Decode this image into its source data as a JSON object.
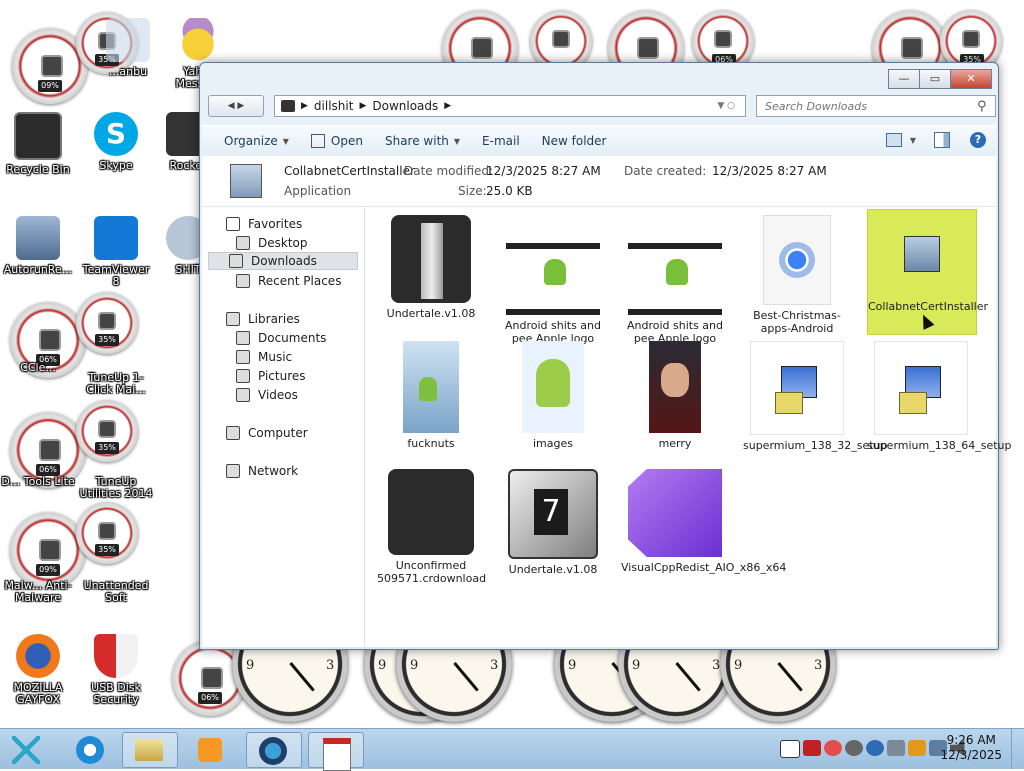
{
  "desktop": {
    "icons": [
      {
        "label": "Recycle Bin"
      },
      {
        "label": "Skype"
      },
      {
        "label": "Rocket"
      },
      {
        "label": "AutorunRe..."
      },
      {
        "label": "TeamViewer 8"
      },
      {
        "label": "SHIT"
      },
      {
        "label": "CCle..."
      },
      {
        "label": "TuneUp 1-Click Mai..."
      },
      {
        "label": "D... Tools Lite"
      },
      {
        "label": "TuneUp Utilities 2014"
      },
      {
        "label": "Malw... Anti-Malware"
      },
      {
        "label": "Unattended Soft"
      },
      {
        "label": "MOZILLA GAYFOX"
      },
      {
        "label": "USB Disk Security"
      },
      {
        "label": "...anbu"
      },
      {
        "label": "Yah... Messe..."
      }
    ],
    "gauge_readings": [
      "09%",
      "35%",
      "06%",
      "35%",
      "06%",
      "35%",
      "09%",
      "35%",
      "06%",
      "35%",
      "35%",
      "06%"
    ]
  },
  "window": {
    "controls": {
      "minimize": "—",
      "maximize": "▭",
      "close": "✕"
    },
    "address": {
      "segments": [
        "dillshit",
        "Downloads"
      ]
    },
    "search": {
      "placeholder": "Search Downloads"
    },
    "toolbar": {
      "organize": "Organize",
      "open": "Open",
      "share_with": "Share with",
      "email": "E-mail",
      "new_folder": "New folder"
    },
    "details": {
      "name": "CollabnetCertInstaller",
      "type": "Application",
      "date_modified_label": "Date modified:",
      "date_modified": "12/3/2025 8:27 AM",
      "size_label": "Size:",
      "size": "25.0 KB",
      "date_created_label": "Date created:",
      "date_created": "12/3/2025 8:27 AM"
    },
    "nav": {
      "favorites": "Favorites",
      "desktop": "Desktop",
      "downloads": "Downloads",
      "recent_places": "Recent Places",
      "libraries": "Libraries",
      "documents": "Documents",
      "music": "Music",
      "pictures": "Pictures",
      "videos": "Videos",
      "computer": "Computer",
      "network": "Network"
    },
    "files": [
      {
        "name": "Undertale.v1.08",
        "icon": "archive-icon"
      },
      {
        "name": "Android shits and pee Apple logo",
        "icon": "video-thumb"
      },
      {
        "name": "Android shits and pee Apple logo",
        "icon": "video-thumb"
      },
      {
        "name": "Best-Christmas-apps-Android",
        "icon": "chrome-document"
      },
      {
        "name": "CollabnetCertInstaller",
        "icon": "installer-icon"
      },
      {
        "name": "fucknuts",
        "icon": "image-thumb"
      },
      {
        "name": "images",
        "icon": "image-thumb"
      },
      {
        "name": "merry",
        "icon": "image-thumb"
      },
      {
        "name": "supermium_138_32_setup",
        "icon": "installer-icon"
      },
      {
        "name": "supermium_138_64_setup",
        "icon": "installer-icon"
      },
      {
        "name": "Unconfirmed 509571.crdownload",
        "icon": "blank-file-icon"
      },
      {
        "name": "Undertale.v1.08",
        "icon": "7zip-icon"
      },
      {
        "name": "VisualCppRedist_AIO_x86_x64",
        "icon": "visual-studio-icon"
      }
    ]
  },
  "taskbar": {
    "time": "9:26 AM",
    "date": "12/3/2025"
  },
  "colors": {
    "selection": "#d8ea57",
    "taskbar": "#a9c9e6",
    "window_frame": "#dde8f3"
  }
}
